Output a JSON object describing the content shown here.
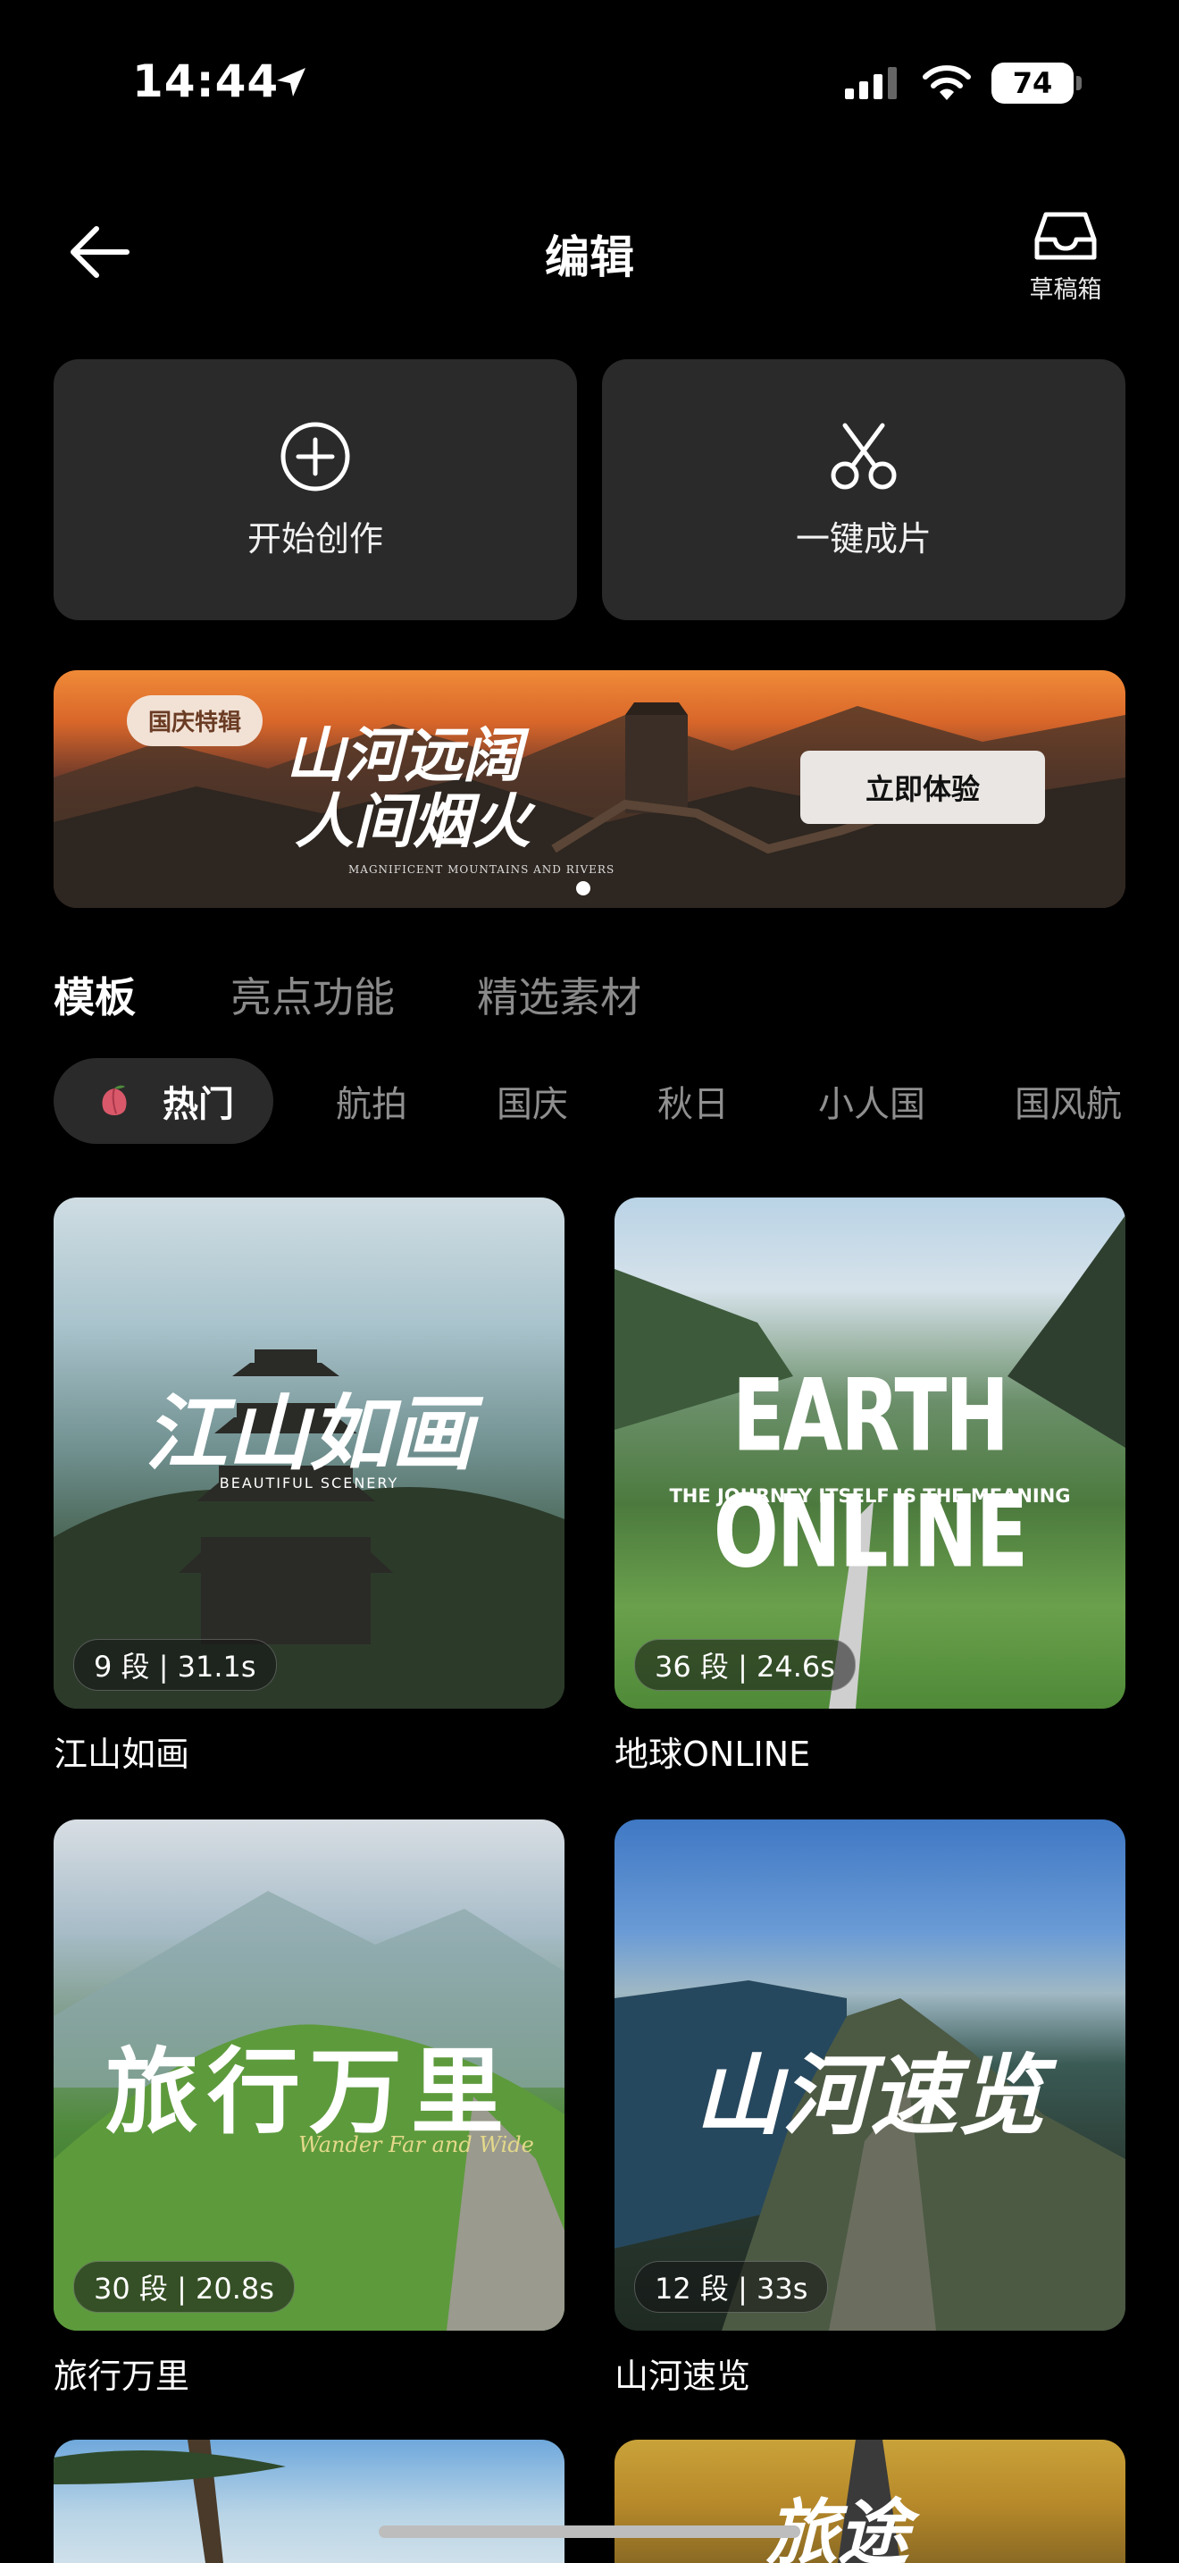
{
  "status_bar": {
    "time": "14:44",
    "battery": "74"
  },
  "header": {
    "title": "编辑",
    "drafts_label": "草稿箱"
  },
  "actions": [
    {
      "label": "开始创作",
      "icon": "plus-circle-icon"
    },
    {
      "label": "一键成片",
      "icon": "scissors-icon"
    }
  ],
  "banner": {
    "tag": "国庆特辑",
    "title_line1": "山河远阔",
    "title_line2": "人间烟火",
    "subtitle": "MAGNIFICENT MOUNTAINS AND RIVERS",
    "button": "立即体验"
  },
  "section_tabs": [
    "模板",
    "亮点功能",
    "精选素材"
  ],
  "categories": [
    "热门",
    "航拍",
    "国庆",
    "秋日",
    "小人国",
    "国风航"
  ],
  "templates": [
    {
      "name": "江山如画",
      "badge": "9 段 | 31.1s",
      "overlay_title": "江山如画",
      "overlay_sub": "BEAUTIFUL SCENERY"
    },
    {
      "name": "地球ONLINE",
      "badge": "36 段 | 24.6s",
      "overlay_title": "EARTH ONLINE",
      "overlay_sub": "THE JOURNEY ITSELF IS THE MEANING"
    },
    {
      "name": "旅行万里",
      "badge": "30 段 | 20.8s",
      "overlay_title": "旅行万里",
      "overlay_sub": "Wander Far and Wide"
    },
    {
      "name": "山河速览",
      "badge": "12 段 | 33s",
      "overlay_title": "山河速览",
      "overlay_sub": ""
    }
  ],
  "partial_row": {
    "overlay_title": "旅途"
  }
}
